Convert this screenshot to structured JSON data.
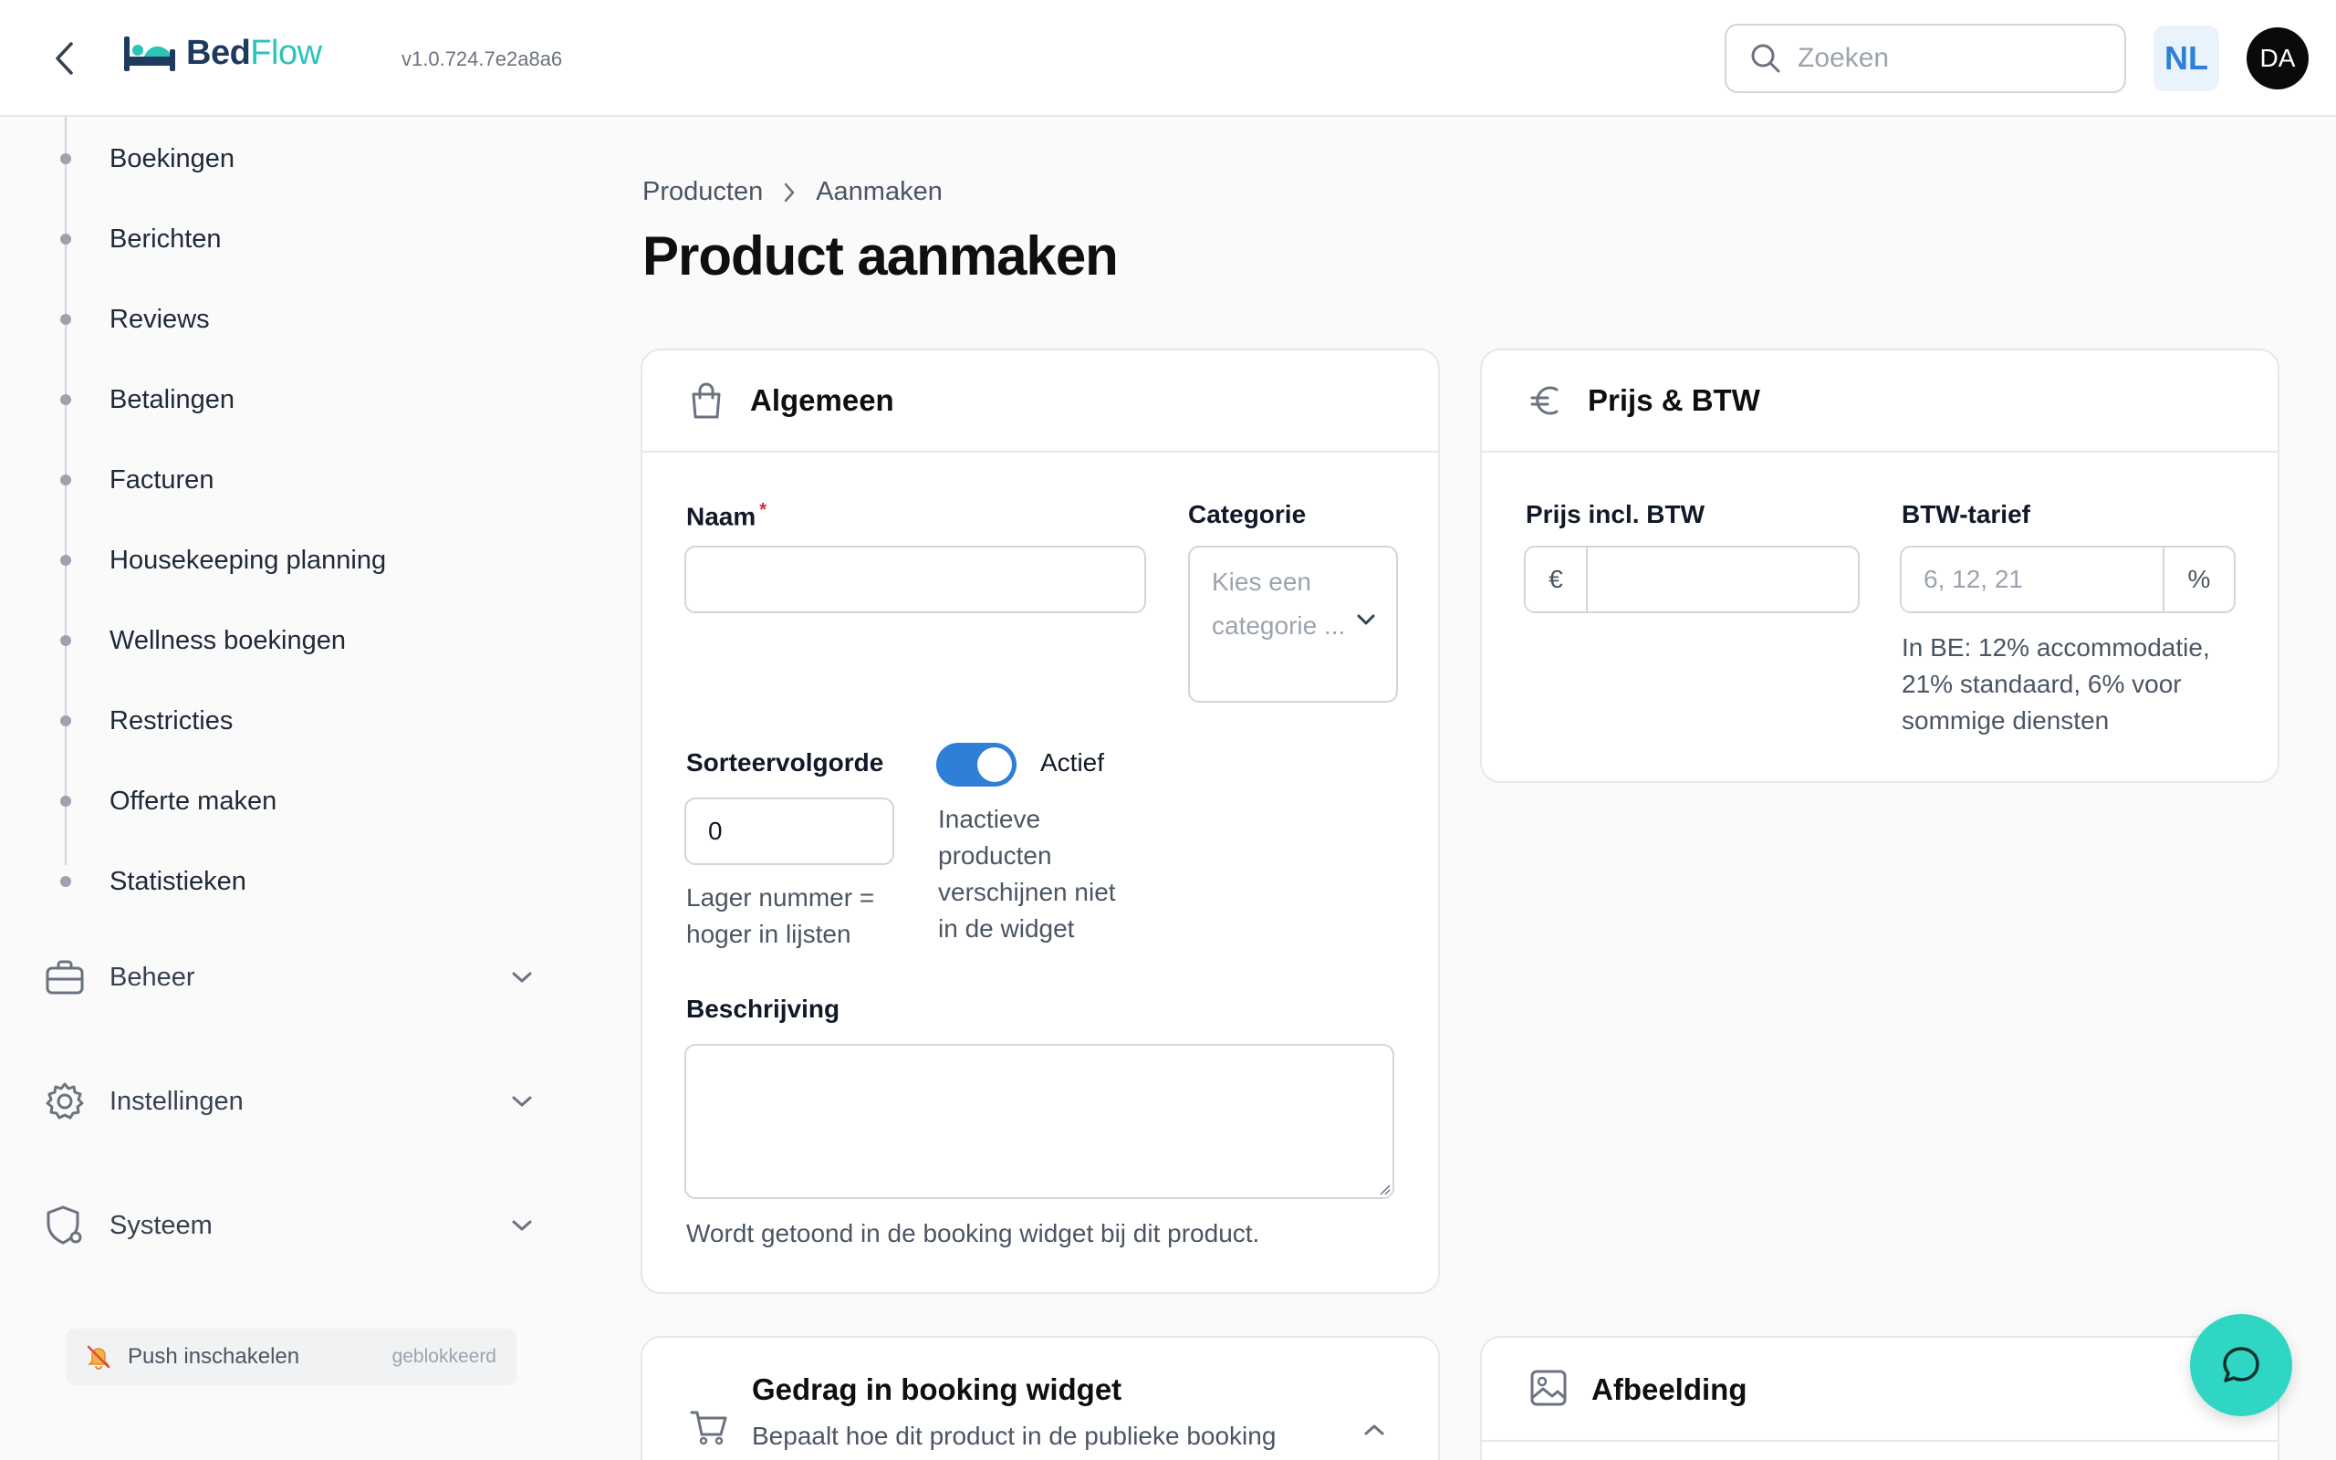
{
  "header": {
    "logo_bed": "Bed",
    "logo_flow": "Flow",
    "version": "v1.0.724.7e2a8a6",
    "search_placeholder": "Zoeken",
    "language": "NL",
    "user_initials": "DA"
  },
  "sidebar": {
    "sub_items": [
      "Boekingen",
      "Berichten",
      "Reviews",
      "Betalingen",
      "Facturen",
      "Housekeeping planning",
      "Wellness boekingen",
      "Restricties",
      "Offerte maken",
      "Statistieken"
    ],
    "groups": [
      {
        "label": "Beheer",
        "icon": "briefcase-icon"
      },
      {
        "label": "Instellingen",
        "icon": "gear-icon"
      },
      {
        "label": "Systeem",
        "icon": "shield-gear-icon"
      }
    ],
    "push": {
      "label": "Push inschakelen",
      "status": "geblokkeerd",
      "icon": "bell-off-icon"
    }
  },
  "breadcrumb": {
    "parent": "Producten",
    "current": "Aanmaken"
  },
  "page_title": "Product aanmaken",
  "general_card": {
    "title": "Algemeen",
    "name_label": "Naam",
    "name_required": "*",
    "name_value": "",
    "category_label": "Categorie",
    "category_placeholder": "Kies een categorie ...",
    "sort_label": "Sorteervolgorde",
    "sort_value": "0",
    "sort_help": "Lager nummer = hoger in lijsten",
    "active_label": "Actief",
    "active_on": true,
    "active_help": "Inactieve producten verschijnen niet in de widget",
    "description_label": "Beschrijving",
    "description_help": "Wordt getoond in de booking widget bij dit product."
  },
  "price_card": {
    "title": "Prijs & BTW",
    "price_label": "Prijs incl. BTW",
    "currency_prefix": "€",
    "vat_label": "BTW-tarief",
    "vat_placeholder": "6, 12, 21",
    "vat_suffix": "%",
    "vat_help": "In BE: 12% accommodatie, 21% standaard, 6% voor sommige diensten"
  },
  "behavior_card": {
    "title": "Gedrag in booking widget",
    "subtitle": "Bepaalt hoe dit product in de publieke booking"
  },
  "image_card": {
    "title": "Afbeelding"
  },
  "colors": {
    "accent": "#2f7ed8",
    "brand_teal": "#2cc4b8",
    "chat_fab": "#2fd6c4"
  }
}
